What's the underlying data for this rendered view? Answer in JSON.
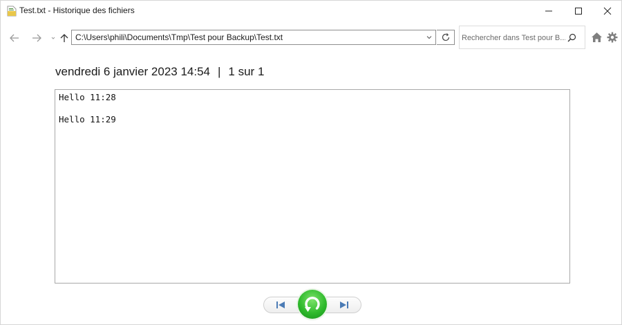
{
  "window": {
    "title": "Test.txt - Historique des fichiers"
  },
  "navigation": {
    "address_path": "C:\\Users\\phili\\Documents\\Tmp\\Test pour Backup\\Test.txt",
    "search_placeholder": "Rechercher dans Test pour B..."
  },
  "version": {
    "datetime": "vendredi 6 janvier 2023 14:54",
    "separator": "|",
    "position": "1 sur 1"
  },
  "file_content": {
    "lines": [
      "Hello 11:28",
      "",
      "Hello 11:29"
    ]
  },
  "icons": {
    "app": "text-file-history-icon",
    "minimize": "minimize-icon",
    "maximize": "maximize-icon",
    "close": "close-icon",
    "back": "arrow-left-icon",
    "forward": "arrow-right-icon",
    "recent": "chevron-down-icon",
    "up": "arrow-up-icon",
    "refresh": "refresh-icon",
    "search": "search-icon",
    "home": "home-icon",
    "settings": "gear-icon",
    "previous": "skip-previous-icon",
    "restore": "restore-icon",
    "next": "skip-next-icon"
  },
  "colors": {
    "restore_green": "#2fba2c",
    "icon_gray": "#8a8a8a",
    "border_gray": "#8e8e8e"
  }
}
